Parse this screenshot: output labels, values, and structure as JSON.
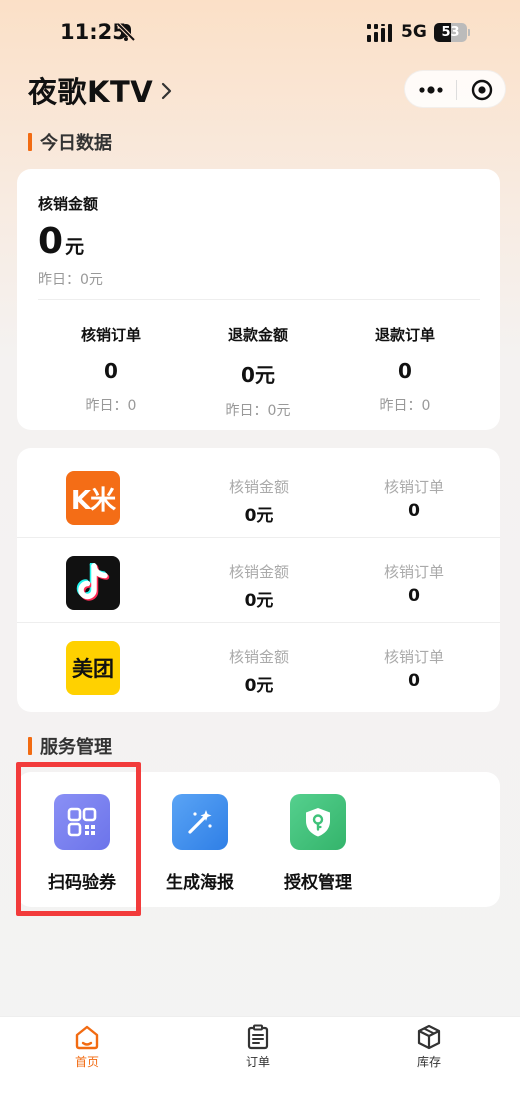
{
  "status_bar": {
    "time": "11:25",
    "network": "5G",
    "battery": "53",
    "battery_level": 0.53
  },
  "header": {
    "title": "夜歌KTV"
  },
  "today": {
    "section_title": "今日数据",
    "writeoff_amount_label": "核销金额",
    "writeoff_amount_value": "0",
    "writeoff_amount_unit": "元",
    "writeoff_amount_yesterday": "昨日：0元",
    "stats": [
      {
        "label": "核销订单",
        "value": "0",
        "yesterday": "昨日：0"
      },
      {
        "label": "退款金额",
        "value": "0元",
        "yesterday": "昨日：0元"
      },
      {
        "label": "退款订单",
        "value": "0",
        "yesterday": "昨日：0"
      }
    ]
  },
  "platforms": [
    {
      "name": "kmi",
      "logo_text": "K米",
      "amount_label": "核销金额",
      "amount": "0元",
      "orders_label": "核销订单",
      "orders": "0"
    },
    {
      "name": "douyin",
      "logo_text": "",
      "amount_label": "核销金额",
      "amount": "0元",
      "orders_label": "核销订单",
      "orders": "0"
    },
    {
      "name": "meituan",
      "logo_text": "美团",
      "amount_label": "核销金额",
      "amount": "0元",
      "orders_label": "核销订单",
      "orders": "0"
    }
  ],
  "services": {
    "section_title": "服务管理",
    "items": [
      {
        "label": "扫码验券",
        "icon": "qr-scan-icon",
        "color": "#7b83f0"
      },
      {
        "label": "生成海报",
        "icon": "magic-wand-icon",
        "color": "#3d8ff0"
      },
      {
        "label": "授权管理",
        "icon": "shield-key-icon",
        "color": "#3fc27a"
      }
    ]
  },
  "tabs": [
    {
      "label": "首页",
      "icon": "home-icon",
      "active": true
    },
    {
      "label": "订单",
      "icon": "clipboard-icon",
      "active": false
    },
    {
      "label": "库存",
      "icon": "box-icon",
      "active": false
    }
  ],
  "colors": {
    "accent": "#f26b12",
    "highlight": "#f23b3b"
  }
}
